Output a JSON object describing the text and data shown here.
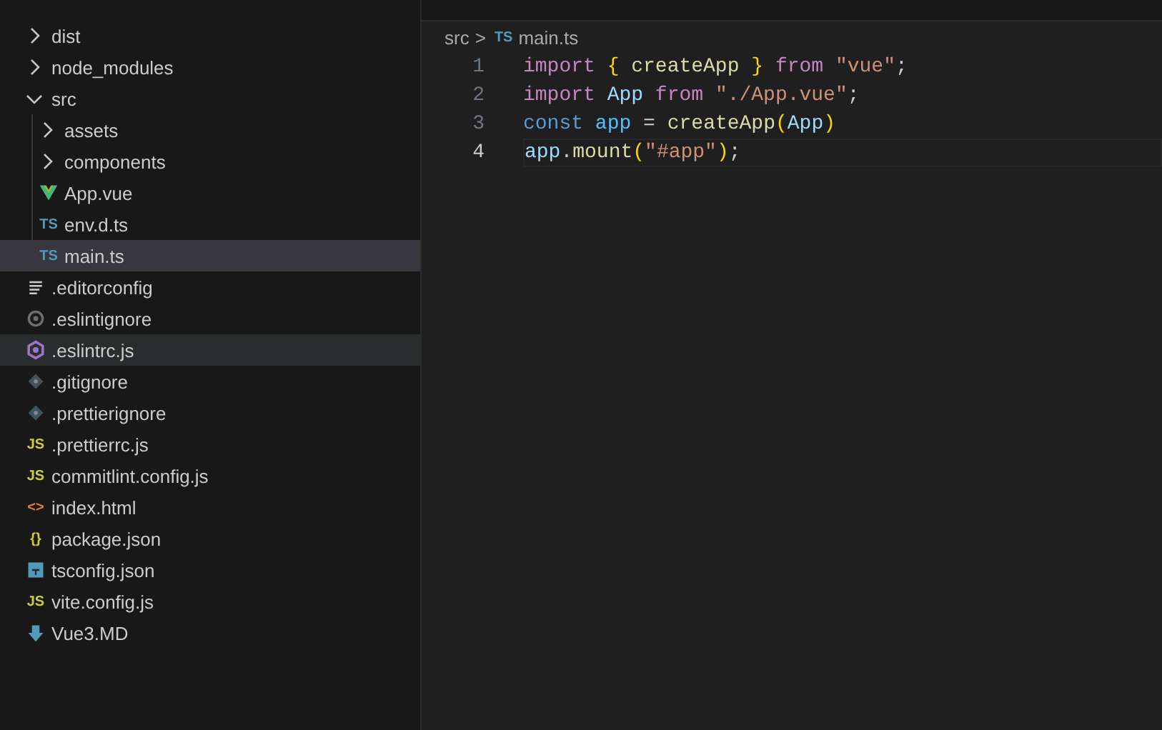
{
  "explorer": {
    "items": [
      {
        "kind": "folder",
        "name": "dist",
        "expanded": false,
        "selected": false,
        "hovered": false
      },
      {
        "kind": "folder",
        "name": "node_modules",
        "expanded": false,
        "selected": false,
        "hovered": false
      },
      {
        "kind": "folder",
        "name": "src",
        "expanded": true,
        "selected": false,
        "hovered": false,
        "children": [
          {
            "kind": "folder",
            "name": "assets",
            "expanded": false,
            "selected": false,
            "hovered": false
          },
          {
            "kind": "folder",
            "name": "components",
            "expanded": false,
            "selected": false,
            "hovered": false
          },
          {
            "kind": "vue",
            "name": "App.vue",
            "selected": false,
            "hovered": false
          },
          {
            "kind": "badge",
            "badge": "TS",
            "color": "#519aba",
            "name": "env.d.ts",
            "selected": false,
            "hovered": false
          },
          {
            "kind": "badge",
            "badge": "TS",
            "color": "#519aba",
            "name": "main.ts",
            "selected": true,
            "hovered": false
          }
        ]
      },
      {
        "kind": "lines",
        "name": ".editorconfig",
        "selected": false,
        "hovered": false
      },
      {
        "kind": "gear",
        "name": ".eslintignore",
        "selected": false,
        "hovered": false
      },
      {
        "kind": "hexagon",
        "name": ".eslintrc.js",
        "selected": false,
        "hovered": true
      },
      {
        "kind": "diamond",
        "name": ".gitignore",
        "selected": false,
        "hovered": false
      },
      {
        "kind": "diamond",
        "name": ".prettierignore",
        "selected": false,
        "hovered": false
      },
      {
        "kind": "badge",
        "badge": "JS",
        "color": "#cbcb41",
        "name": ".prettierrc.js",
        "selected": false,
        "hovered": false
      },
      {
        "kind": "badge",
        "badge": "JS",
        "color": "#cbcb41",
        "name": "commitlint.config.js",
        "selected": false,
        "hovered": false
      },
      {
        "kind": "badge",
        "badge": "<>",
        "color": "#e37933",
        "name": "index.html",
        "selected": false,
        "hovered": false
      },
      {
        "kind": "badge",
        "badge": "{}",
        "color": "#cbcb41",
        "name": "package.json",
        "selected": false,
        "hovered": false
      },
      {
        "kind": "square",
        "name": "tsconfig.json",
        "selected": false,
        "hovered": false
      },
      {
        "kind": "badge",
        "badge": "JS",
        "color": "#cbcb41",
        "name": "vite.config.js",
        "selected": false,
        "hovered": false
      },
      {
        "kind": "arrow",
        "name": "Vue3.MD",
        "selected": false,
        "hovered": false
      }
    ]
  },
  "breadcrumb": {
    "folder": "src",
    "separator": ">",
    "badge": "TS",
    "file": "main.ts"
  },
  "editor": {
    "lines": [
      {
        "number": "1",
        "current": false,
        "tokens": [
          {
            "kind": "keyword",
            "text": "import "
          },
          {
            "kind": "brace",
            "text": "{ "
          },
          {
            "kind": "function",
            "text": "createApp "
          },
          {
            "kind": "brace",
            "text": "} "
          },
          {
            "kind": "keyword",
            "text": "from "
          },
          {
            "kind": "string",
            "text": "\"vue\""
          },
          {
            "kind": "plain",
            "text": ";"
          }
        ]
      },
      {
        "number": "2",
        "current": false,
        "tokens": [
          {
            "kind": "keyword",
            "text": "import "
          },
          {
            "kind": "variable",
            "text": "App "
          },
          {
            "kind": "keyword",
            "text": "from "
          },
          {
            "kind": "string",
            "text": "\"./App.vue\""
          },
          {
            "kind": "plain",
            "text": ";"
          }
        ]
      },
      {
        "number": "3",
        "current": false,
        "tokens": [
          {
            "kind": "storage",
            "text": "const "
          },
          {
            "kind": "constant",
            "text": "app"
          },
          {
            "kind": "plain",
            "text": " = "
          },
          {
            "kind": "function",
            "text": "createApp"
          },
          {
            "kind": "brace",
            "text": "("
          },
          {
            "kind": "variable",
            "text": "App"
          },
          {
            "kind": "brace",
            "text": ")"
          }
        ]
      },
      {
        "number": "4",
        "current": true,
        "tokens": [
          {
            "kind": "variable",
            "text": "app"
          },
          {
            "kind": "plain",
            "text": "."
          },
          {
            "kind": "function",
            "text": "mount"
          },
          {
            "kind": "brace",
            "text": "("
          },
          {
            "kind": "string",
            "text": "\"#app\""
          },
          {
            "kind": "brace",
            "text": ")"
          },
          {
            "kind": "plain",
            "text": ";"
          }
        ]
      }
    ]
  }
}
